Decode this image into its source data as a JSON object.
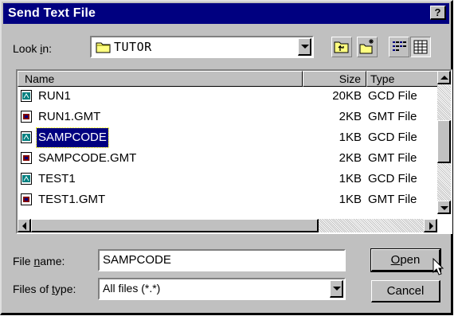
{
  "window": {
    "title": "Send Text File",
    "help_label": "?"
  },
  "look_in": {
    "label_pre": "Look ",
    "label_key": "i",
    "label_post": "n:",
    "value": "TUTOR"
  },
  "columns": {
    "name": "Name",
    "size": "Size",
    "type": "Type"
  },
  "files": [
    {
      "name": "RUN1",
      "size": "20KB",
      "type": "GCD File",
      "icon": "gcd-file-icon"
    },
    {
      "name": "RUN1.GMT",
      "size": "2KB",
      "type": "GMT File",
      "icon": "gmt-file-icon"
    },
    {
      "name": "SAMPCODE",
      "size": "1KB",
      "type": "GCD File",
      "icon": "gcd-file-icon",
      "selected": true
    },
    {
      "name": "SAMPCODE.GMT",
      "size": "2KB",
      "type": "GMT File",
      "icon": "gmt-file-icon"
    },
    {
      "name": "TEST1",
      "size": "1KB",
      "type": "GCD File",
      "icon": "gcd-file-icon"
    },
    {
      "name": "TEST1.GMT",
      "size": "1KB",
      "type": "GMT File",
      "icon": "gmt-file-icon"
    }
  ],
  "file_name": {
    "label_pre": "File ",
    "label_key": "n",
    "label_post": "ame:",
    "value": "SAMPCODE"
  },
  "file_type": {
    "label_pre": "Files of ",
    "label_key": "t",
    "label_post": "ype:",
    "value": "All files (*.*)"
  },
  "buttons": {
    "open_key": "O",
    "open_rest": "pen",
    "cancel": "Cancel"
  },
  "colors": {
    "titlebar": "#000080",
    "face": "#c0c0c0",
    "selection": "#000080"
  }
}
